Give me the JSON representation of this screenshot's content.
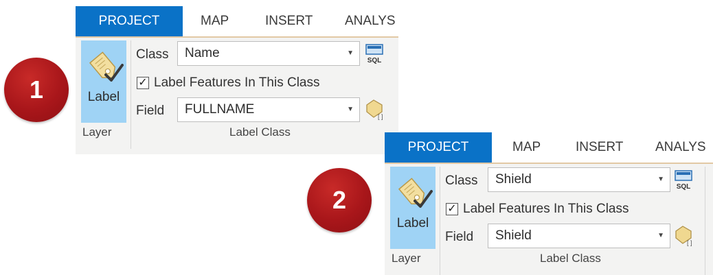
{
  "badges": [
    "1",
    "2"
  ],
  "ribbons": [
    {
      "tabs": [
        "PROJECT",
        "MAP",
        "INSERT",
        "ANALYS"
      ],
      "label_button": "Label",
      "class_label": "Class",
      "class_value": "Name",
      "checkbox_label": "Label Features In This Class",
      "checkbox_checked": true,
      "field_label": "Field",
      "field_value": "FULLNAME",
      "group_layer": "Layer",
      "group_label_class": "Label Class",
      "sql_icon_text": "SQL"
    },
    {
      "tabs": [
        "PROJECT",
        "MAP",
        "INSERT",
        "ANALYS"
      ],
      "label_button": "Label",
      "class_label": "Class",
      "class_value": "Shield",
      "checkbox_label": "Label Features In This Class",
      "checkbox_checked": true,
      "field_label": "Field",
      "field_value": "Shield",
      "group_layer": "Layer",
      "group_label_class": "Label Class",
      "sql_icon_text": "SQL"
    }
  ],
  "colors": {
    "active_tab": "#0a72c7",
    "label_button": "#9fd3f5",
    "badge": "#a8161a"
  }
}
